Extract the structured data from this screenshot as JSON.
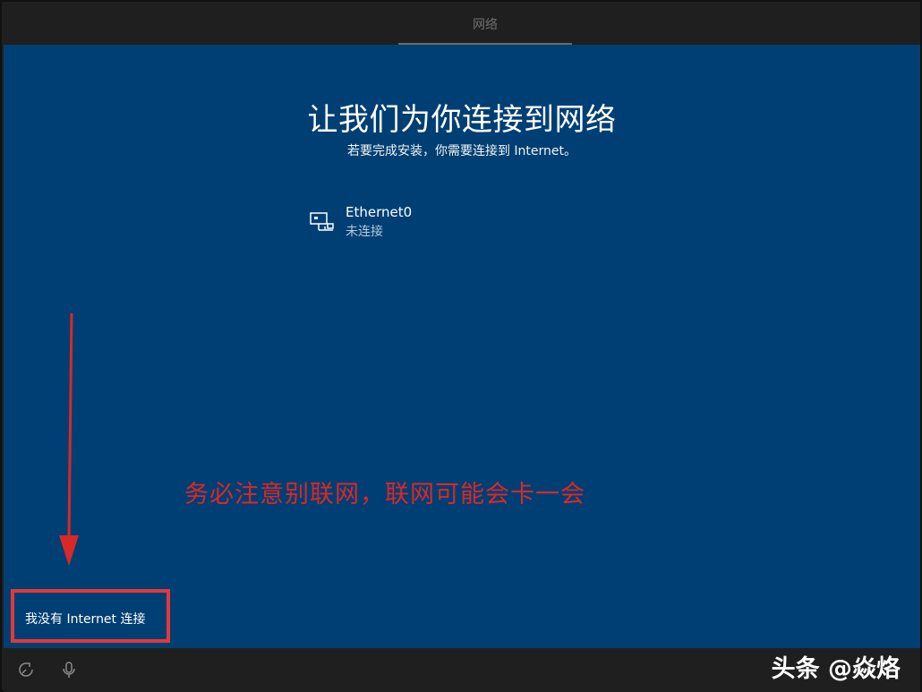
{
  "header": {
    "tab_label": "网络"
  },
  "main": {
    "title": "让我们为你连接到网络",
    "subtitle": "若要完成安装，你需要连接到 Internet。",
    "network": {
      "name": "Ethernet0",
      "status": "未连接",
      "icon": "ethernet-icon"
    },
    "no_internet_label": "我没有 Internet 连接"
  },
  "annotation": {
    "text": "务必注意别联网，联网可能会卡一会"
  },
  "footer": {
    "icons": [
      "accessibility-icon",
      "microphone-icon"
    ]
  },
  "watermark": {
    "text": "头条 @焱烙"
  },
  "colors": {
    "panel": "#003f73",
    "annotation": "#d92828",
    "highlight_box": "#e43838"
  }
}
